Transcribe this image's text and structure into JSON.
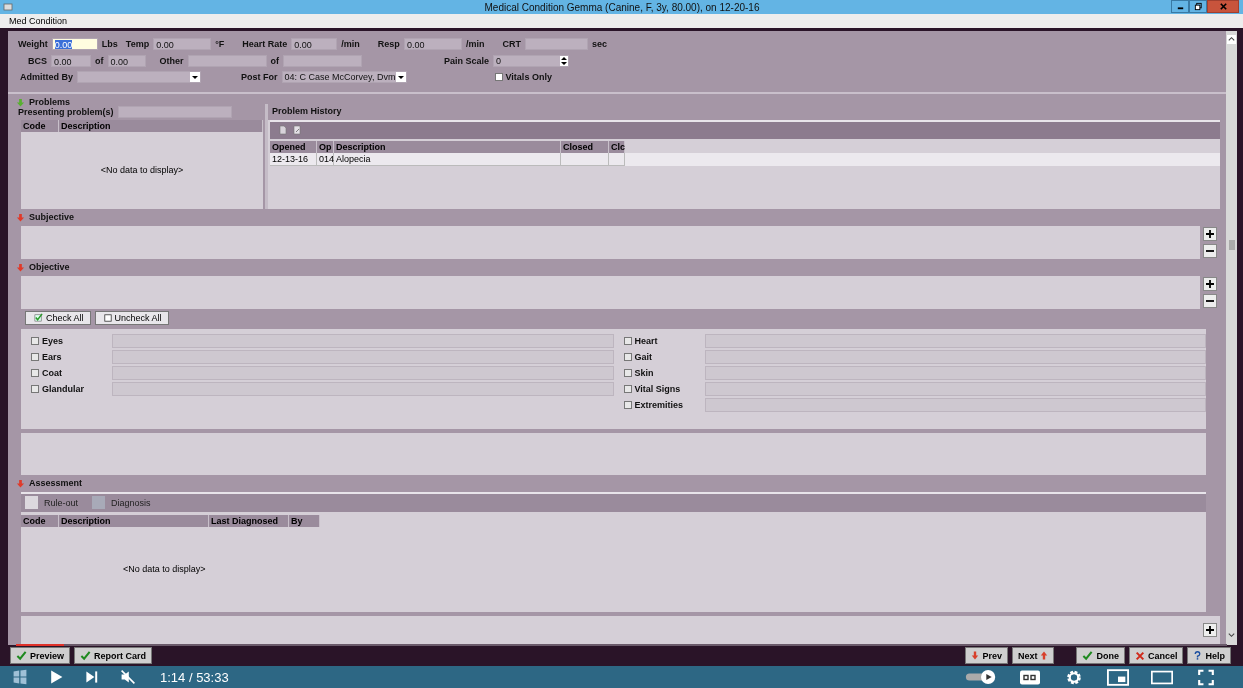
{
  "window": {
    "title": "Medical Condition  Gemma (Canine, F, 3y, 80.00), on 12-20-16"
  },
  "menu": [
    "Med Condition"
  ],
  "vitals": {
    "weight": {
      "label": "Weight",
      "value": "0.00",
      "unit": "Lbs",
      "focused": true
    },
    "temp": {
      "label": "Temp",
      "value": "0.00",
      "unit": "°F"
    },
    "heart_rate": {
      "label": "Heart Rate",
      "value": "0.00",
      "unit": "/min"
    },
    "resp": {
      "label": "Resp",
      "value": "0.00",
      "unit": "/min"
    },
    "crt": {
      "label": "CRT",
      "unit": "sec"
    },
    "bcs": {
      "label": "BCS",
      "value": "0.00",
      "of_label": "of",
      "of_value": "0.00"
    },
    "other": {
      "label": "Other",
      "of_label": "of"
    },
    "pain_scale": {
      "label": "Pain Scale",
      "value": "0"
    },
    "admitted_by": {
      "label": "Admitted By"
    },
    "post_for": {
      "label": "Post For",
      "value": "04: C Case McCorvey, Dvm"
    },
    "vitals_only": {
      "label": "Vitals Only",
      "checked": false
    }
  },
  "sections": [
    {
      "kind": "problems",
      "title": "Problems",
      "color": "#58b030"
    },
    {
      "kind": "subjective",
      "title": "Subjective",
      "color": "#e03a2a"
    },
    {
      "kind": "objective",
      "title": "Objective",
      "color": "#e03a2a"
    },
    {
      "kind": "assessment",
      "title": "Assessment",
      "color": "#e03a2a"
    }
  ],
  "problems": {
    "presenting_label": "Presenting problem(s)",
    "columns": [
      "Code",
      "Description"
    ],
    "empty_text": "<No data to display>",
    "history_title": "Problem History",
    "history_columns": [
      "Opened",
      "Op",
      "Description",
      "Closed",
      "Clc"
    ],
    "history_rows": [
      [
        "12-13-16",
        "014",
        "Alopecia",
        "",
        ""
      ]
    ]
  },
  "objective": {
    "check_all": "Check All",
    "uncheck_all": "Uncheck All",
    "left": [
      {
        "label": "Eyes",
        "checked": false
      },
      {
        "label": "Ears",
        "checked": false
      },
      {
        "label": "Coat",
        "checked": false
      },
      {
        "label": "Glandular",
        "checked": false
      }
    ],
    "right": [
      {
        "label": "Heart",
        "checked": false
      },
      {
        "label": "Gait",
        "checked": false
      },
      {
        "label": "Skin",
        "checked": false
      },
      {
        "label": "Vital Signs",
        "checked": false
      },
      {
        "label": "Extremities",
        "checked": false
      }
    ]
  },
  "assessment": {
    "tabs": [
      {
        "label": "Rule-out",
        "selected": false
      },
      {
        "label": "Diagnosis",
        "selected": true
      }
    ],
    "columns": [
      "Code",
      "Description",
      "Last Diagnosed",
      "By"
    ],
    "empty_text": "<No data to display>"
  },
  "footer": {
    "left": [
      {
        "label": "Preview",
        "kind": "check"
      },
      {
        "label": "Report Card",
        "kind": "check"
      }
    ],
    "right": [
      {
        "label": "Prev",
        "kind": "down"
      },
      {
        "label": "Next",
        "kind": "up"
      },
      {
        "label": "Done",
        "kind": "check"
      },
      {
        "label": "Cancel",
        "kind": "cross"
      },
      {
        "label": "Help",
        "kind": "help"
      }
    ]
  },
  "player": {
    "time": "1:14 / 53:33",
    "level": 0.04
  }
}
